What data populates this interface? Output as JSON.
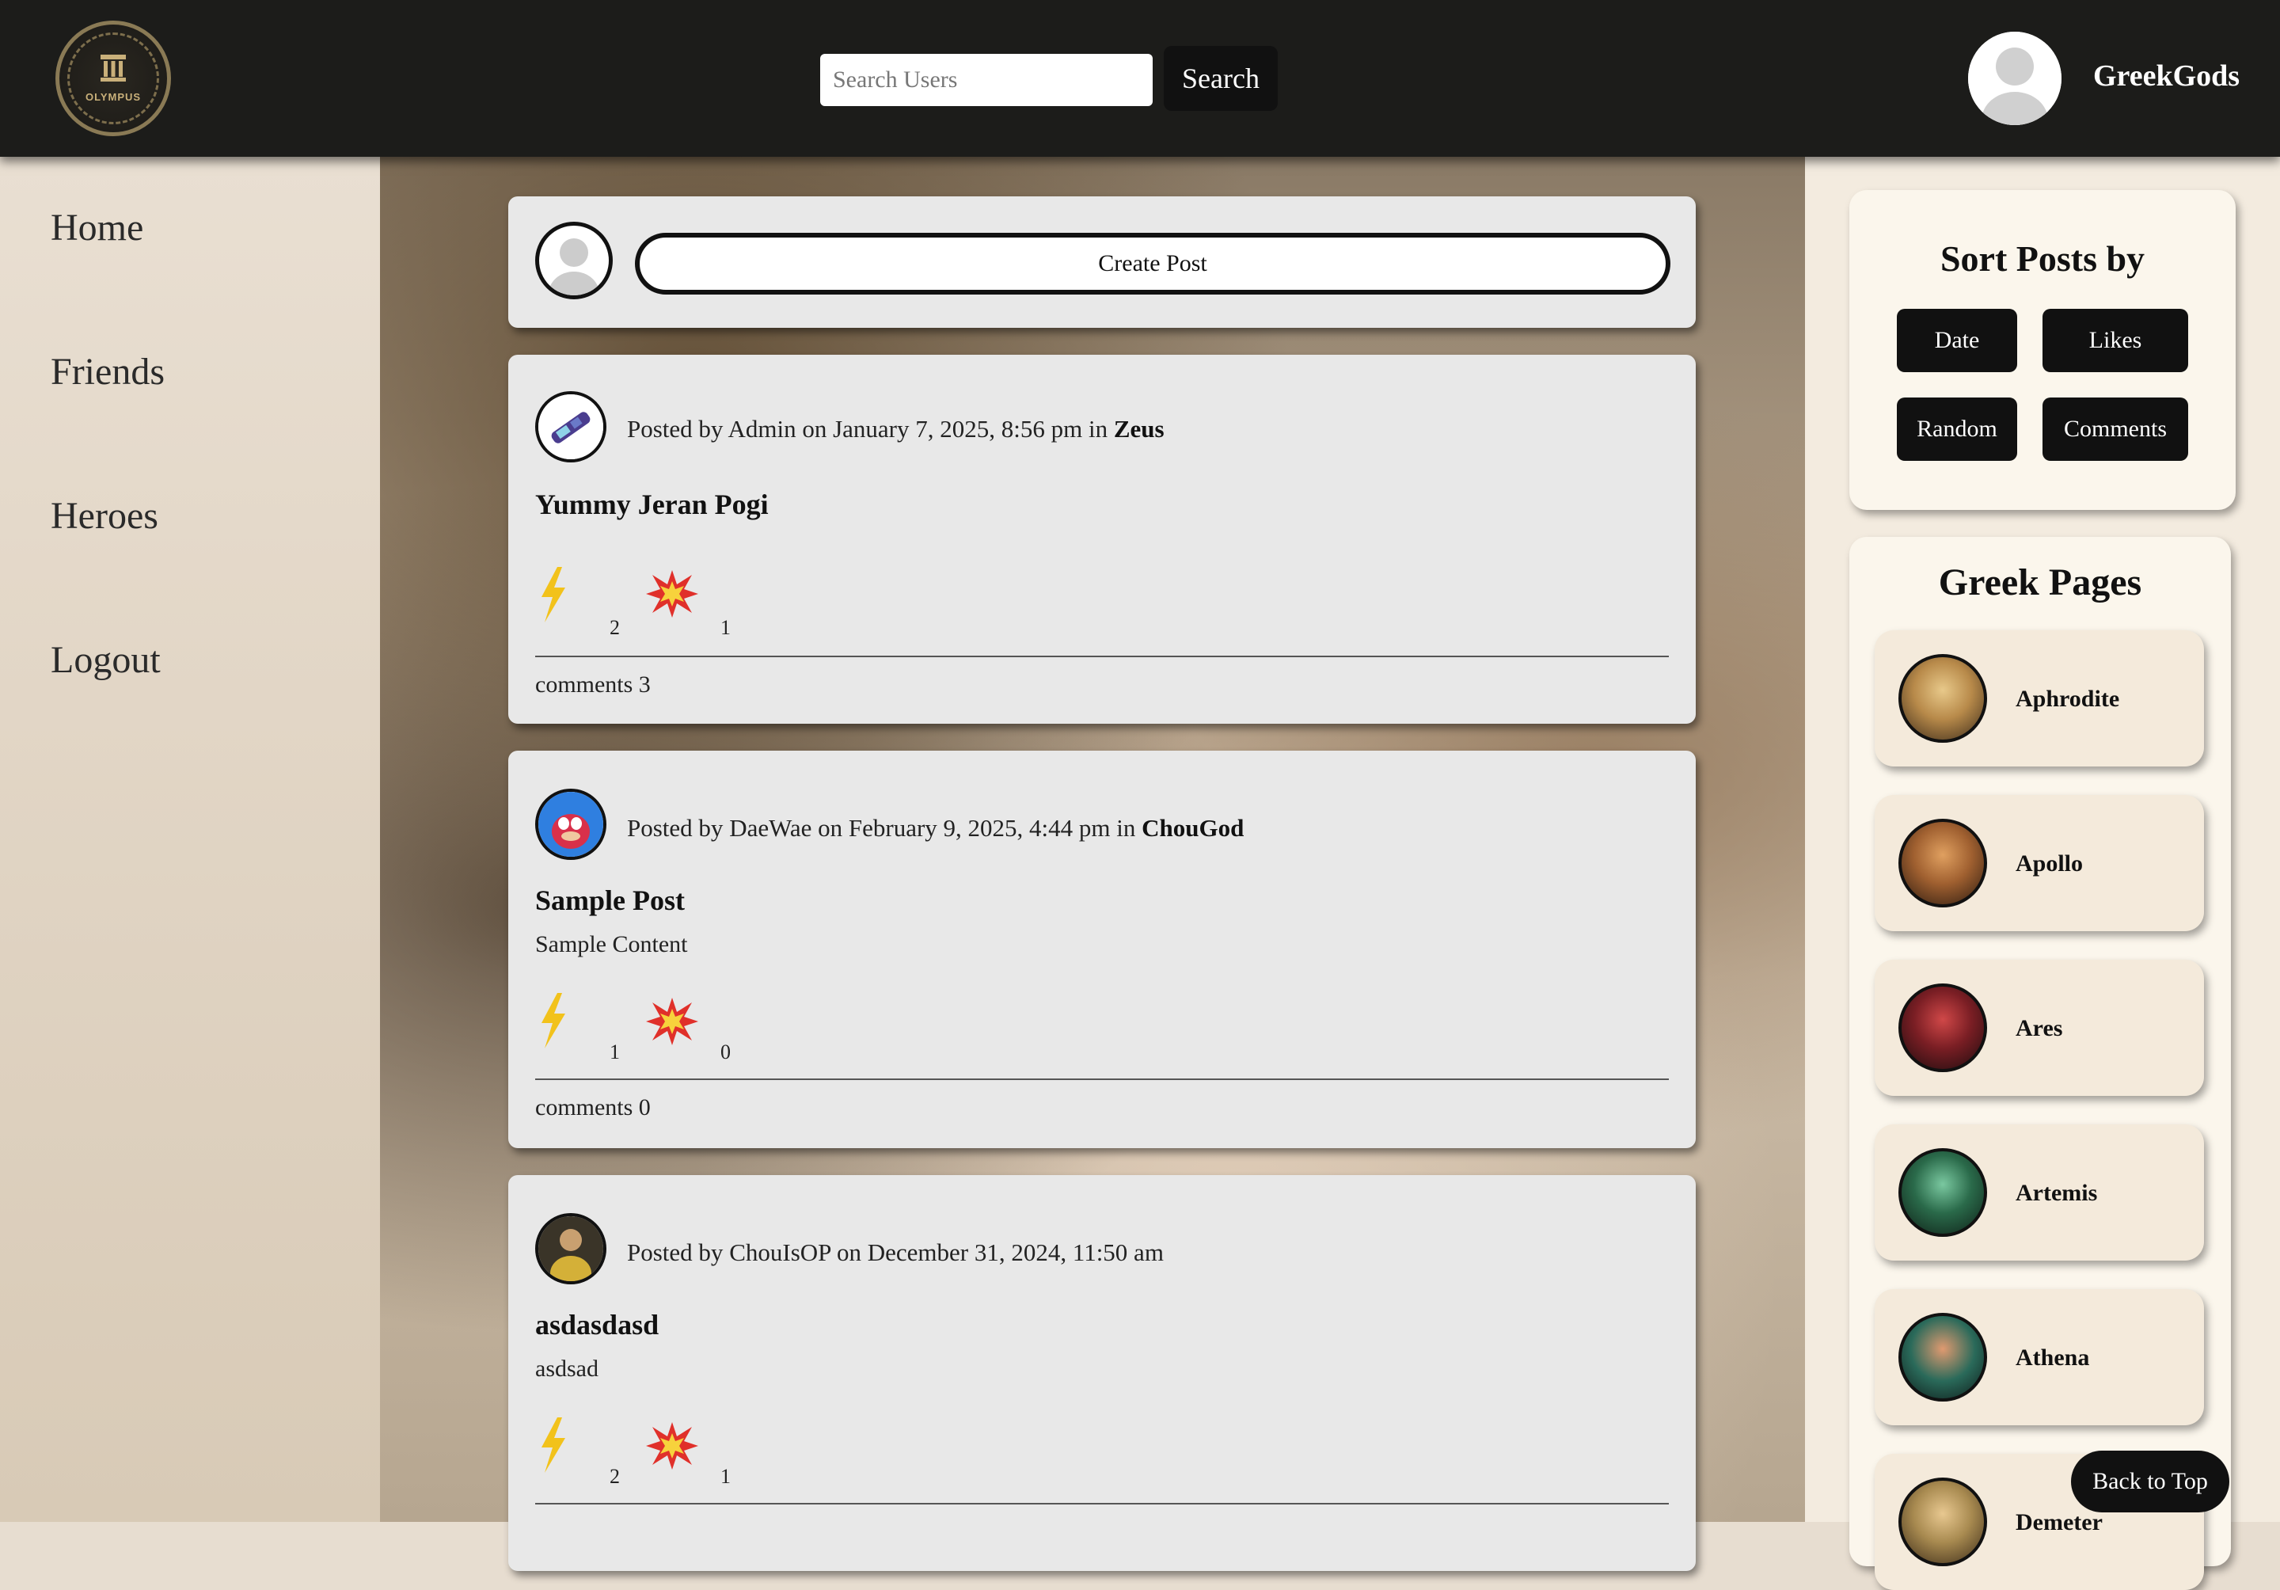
{
  "header": {
    "logo_text": "OLYMPUS",
    "search_placeholder": "Search Users",
    "search_label": "Search",
    "username": "GreekGods"
  },
  "nav": [
    "Home",
    "Friends",
    "Heroes",
    "Logout"
  ],
  "create_post_label": "Create Post",
  "posts": [
    {
      "author": "Admin",
      "date": "January 7, 2025, 8:56 pm",
      "group": "Zeus",
      "title": "Yummy Jeran Pogi",
      "content": "",
      "bolts": "2",
      "booms": "1",
      "comments": "comments 3"
    },
    {
      "author": "DaeWae",
      "date": "February 9, 2025, 4:44 pm",
      "group": "ChouGod",
      "title": "Sample Post",
      "content": "Sample Content",
      "bolts": "1",
      "booms": "0",
      "comments": "comments 0"
    },
    {
      "author": "ChouIsOP",
      "date": "December 31, 2024, 11:50 am",
      "group": "",
      "title": "asdasdasd",
      "content": "asdsad",
      "bolts": "2",
      "booms": "1",
      "comments": ""
    }
  ],
  "sort": {
    "title": "Sort Posts by",
    "options": [
      "Date",
      "Likes",
      "Random",
      "Comments"
    ]
  },
  "pages": {
    "title": "Greek Pages",
    "gods": [
      "Aphrodite",
      "Apollo",
      "Ares",
      "Artemis",
      "Athena",
      "Demeter"
    ]
  },
  "back_to_top": "Back to Top",
  "colors": {
    "header_bg": "#1c1c1a",
    "card_bg": "#e8e8e8",
    "button_bg": "#111111",
    "bolt": "#f2c21b",
    "boom": "#e0302a"
  }
}
